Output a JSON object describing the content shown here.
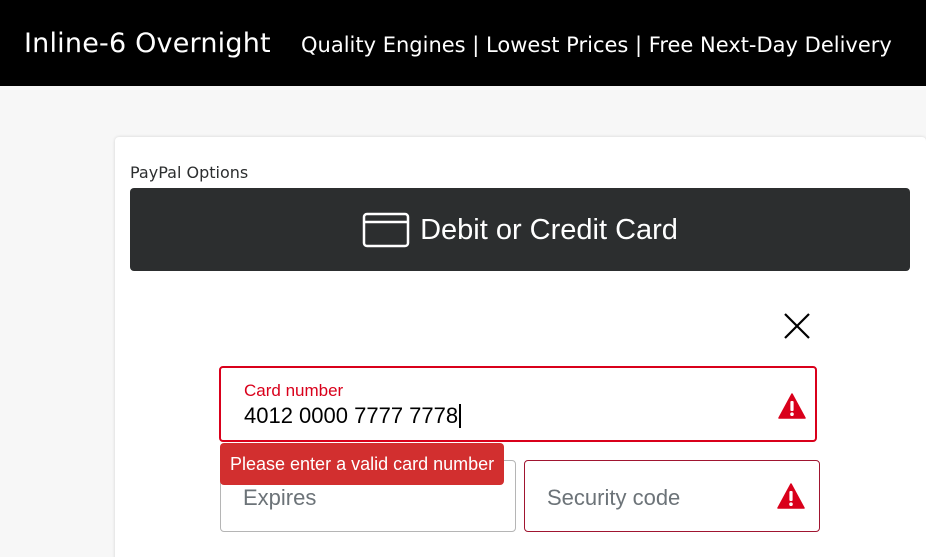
{
  "header": {
    "brand": "Inline-6 Overnight",
    "tagline": "Quality Engines | Lowest Prices | Free Next-Day Delivery"
  },
  "checkout": {
    "options_label": "PayPal Options",
    "card_button_label": "Debit or Credit Card",
    "card_button_icon": "credit-card-icon",
    "close_icon": "close-icon"
  },
  "form": {
    "card_number": {
      "label": "Card number",
      "value": "4012 0000 7777 7778",
      "error": "Please enter a valid card number",
      "status_icon": "warning-icon"
    },
    "expires": {
      "placeholder": "Expires"
    },
    "security_code": {
      "placeholder": "Security code",
      "status_icon": "warning-icon"
    }
  },
  "colors": {
    "header_bg": "#000000",
    "button_bg": "#2c2e2f",
    "error": "#d9001b",
    "error_tooltip": "#d22f2f"
  }
}
